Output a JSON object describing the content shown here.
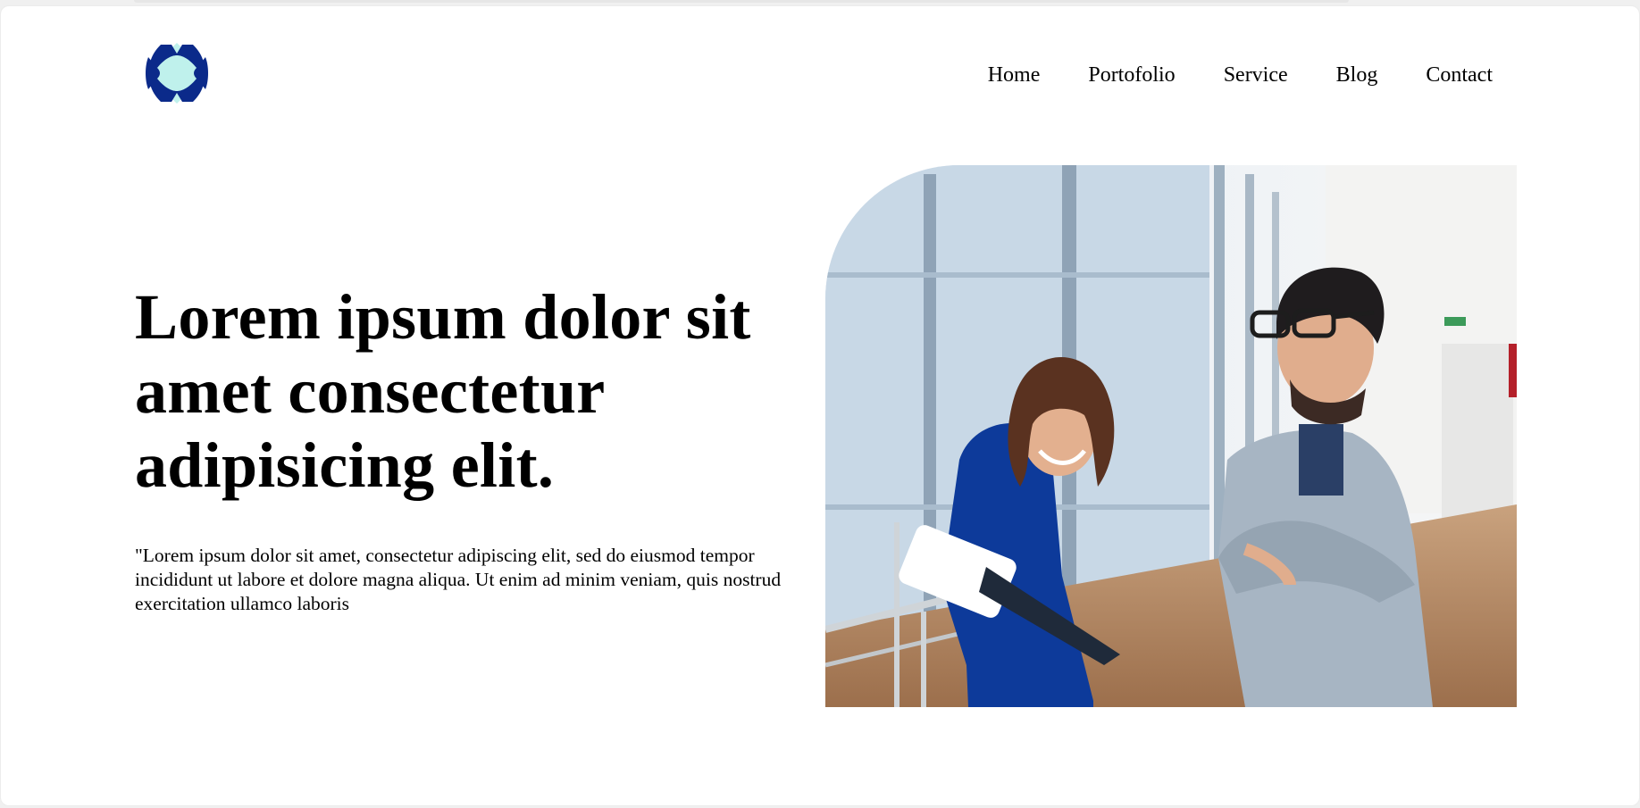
{
  "header": {
    "logo": {
      "name": "logo-icon",
      "colors": {
        "primary": "#0b2a8a",
        "accent": "#bff1ec"
      }
    },
    "nav": [
      {
        "label": "Home"
      },
      {
        "label": "Portofolio"
      },
      {
        "label": "Service"
      },
      {
        "label": "Blog"
      },
      {
        "label": "Contact"
      }
    ]
  },
  "hero": {
    "title": "Lorem ipsum dolor sit amet consectetur adipisicing elit.",
    "text": "\"Lorem ipsum dolor sit amet, consectetur adipiscing elit, sed do eiusmod tempor incididunt ut labore et dolore magna aliqua. Ut enim ad minim veniam, quis nostrud exercitation ullamco laboris",
    "image": {
      "subject": "two-colleagues-office-photo"
    }
  }
}
